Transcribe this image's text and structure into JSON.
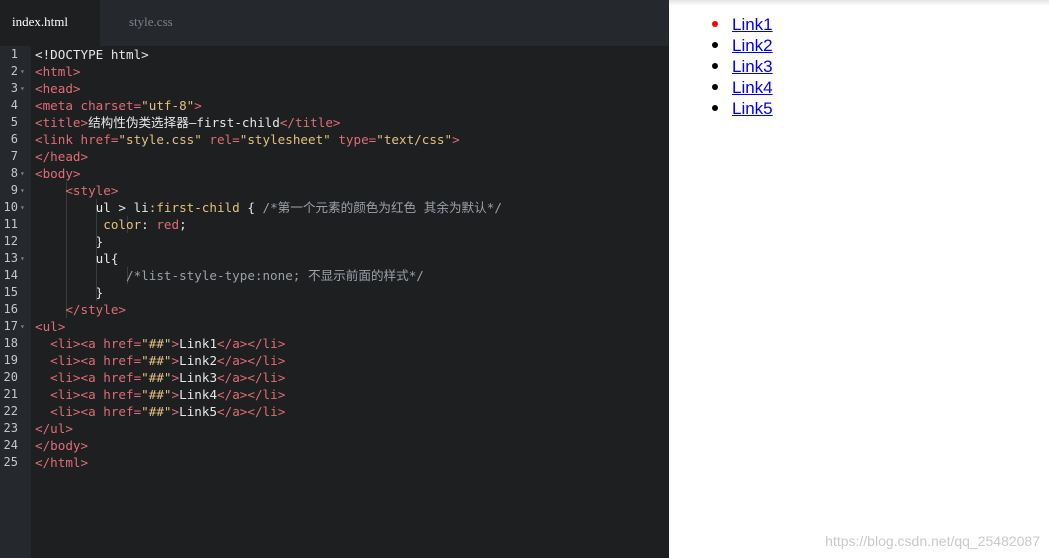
{
  "editor": {
    "tabs": [
      {
        "label": "index.html",
        "active": true
      },
      {
        "label": "style.css",
        "active": false
      }
    ],
    "lines": [
      {
        "num": "1",
        "fold": false,
        "indent": 0,
        "tokens": [
          {
            "t": "<!DOCTYPE html>",
            "c": "text"
          }
        ]
      },
      {
        "num": "2",
        "fold": true,
        "indent": 0,
        "tokens": [
          {
            "t": "<html>",
            "c": "tag"
          }
        ]
      },
      {
        "num": "3",
        "fold": true,
        "indent": 0,
        "tokens": [
          {
            "t": "<head>",
            "c": "tag"
          }
        ]
      },
      {
        "num": "4",
        "fold": false,
        "indent": 0,
        "tokens": [
          {
            "t": "<meta ",
            "c": "tag"
          },
          {
            "t": "charset=",
            "c": "attr"
          },
          {
            "t": "\"utf-8\"",
            "c": "str"
          },
          {
            "t": ">",
            "c": "tag"
          }
        ]
      },
      {
        "num": "5",
        "fold": false,
        "indent": 0,
        "tokens": [
          {
            "t": "<title>",
            "c": "tag"
          },
          {
            "t": "结构性伪类选择器—first-child",
            "c": "text"
          },
          {
            "t": "</title>",
            "c": "tag"
          }
        ]
      },
      {
        "num": "6",
        "fold": false,
        "indent": 0,
        "tokens": [
          {
            "t": "<link ",
            "c": "tag"
          },
          {
            "t": "href=",
            "c": "attr"
          },
          {
            "t": "\"style.css\"",
            "c": "str"
          },
          {
            "t": " rel=",
            "c": "attr"
          },
          {
            "t": "\"stylesheet\"",
            "c": "str"
          },
          {
            "t": " type=",
            "c": "attr"
          },
          {
            "t": "\"text/css\"",
            "c": "str"
          },
          {
            "t": ">",
            "c": "tag"
          }
        ]
      },
      {
        "num": "7",
        "fold": false,
        "indent": 0,
        "tokens": [
          {
            "t": "</head>",
            "c": "tag"
          }
        ]
      },
      {
        "num": "8",
        "fold": true,
        "indent": 0,
        "tokens": [
          {
            "t": "<body>",
            "c": "tag"
          }
        ]
      },
      {
        "num": "9",
        "fold": true,
        "indent": 1,
        "tokens": [
          {
            "t": "    ",
            "c": "text"
          },
          {
            "t": "<style>",
            "c": "tag"
          }
        ]
      },
      {
        "num": "10",
        "fold": true,
        "indent": 2,
        "tokens": [
          {
            "t": "        ul > li",
            "c": "sel"
          },
          {
            "t": ":first-child",
            "c": "pseudo"
          },
          {
            "t": " { ",
            "c": "text"
          },
          {
            "t": "/*第一个元素的颜色为红色 其余为默认*/",
            "c": "comment"
          }
        ]
      },
      {
        "num": "11",
        "fold": false,
        "indent": 3,
        "tokens": [
          {
            "t": "         ",
            "c": "text"
          },
          {
            "t": "color",
            "c": "prop"
          },
          {
            "t": ": ",
            "c": "text"
          },
          {
            "t": "red",
            "c": "val"
          },
          {
            "t": ";",
            "c": "text"
          }
        ]
      },
      {
        "num": "12",
        "fold": false,
        "indent": 2,
        "tokens": [
          {
            "t": "        }",
            "c": "text"
          }
        ]
      },
      {
        "num": "13",
        "fold": true,
        "indent": 2,
        "tokens": [
          {
            "t": "        ul{",
            "c": "sel"
          }
        ]
      },
      {
        "num": "14",
        "fold": false,
        "indent": 3,
        "tokens": [
          {
            "t": "            ",
            "c": "text"
          },
          {
            "t": "/*list-style-type:none; 不显示前面的样式*/",
            "c": "comment"
          }
        ]
      },
      {
        "num": "15",
        "fold": false,
        "indent": 2,
        "tokens": [
          {
            "t": "        }",
            "c": "text"
          }
        ]
      },
      {
        "num": "16",
        "fold": false,
        "indent": 1,
        "tokens": [
          {
            "t": "    ",
            "c": "text"
          },
          {
            "t": "</style>",
            "c": "tag"
          }
        ]
      },
      {
        "num": "17",
        "fold": true,
        "indent": 0,
        "tokens": [
          {
            "t": "<ul>",
            "c": "tag"
          }
        ]
      },
      {
        "num": "18",
        "fold": false,
        "indent": 0,
        "tokens": [
          {
            "t": "  <li><a ",
            "c": "tag"
          },
          {
            "t": "href=",
            "c": "attr"
          },
          {
            "t": "\"##\"",
            "c": "str"
          },
          {
            "t": ">",
            "c": "tag"
          },
          {
            "t": "Link1",
            "c": "text"
          },
          {
            "t": "</a></li>",
            "c": "tag"
          }
        ]
      },
      {
        "num": "19",
        "fold": false,
        "indent": 0,
        "tokens": [
          {
            "t": "  <li><a ",
            "c": "tag"
          },
          {
            "t": "href=",
            "c": "attr"
          },
          {
            "t": "\"##\"",
            "c": "str"
          },
          {
            "t": ">",
            "c": "tag"
          },
          {
            "t": "Link2",
            "c": "text"
          },
          {
            "t": "</a></li>",
            "c": "tag"
          }
        ]
      },
      {
        "num": "20",
        "fold": false,
        "indent": 0,
        "tokens": [
          {
            "t": "  <li><a ",
            "c": "tag"
          },
          {
            "t": "href=",
            "c": "attr"
          },
          {
            "t": "\"##\"",
            "c": "str"
          },
          {
            "t": ">",
            "c": "tag"
          },
          {
            "t": "Link3",
            "c": "text"
          },
          {
            "t": "</a></li>",
            "c": "tag"
          }
        ]
      },
      {
        "num": "21",
        "fold": false,
        "indent": 0,
        "tokens": [
          {
            "t": "  <li><a ",
            "c": "tag"
          },
          {
            "t": "href=",
            "c": "attr"
          },
          {
            "t": "\"##\"",
            "c": "str"
          },
          {
            "t": ">",
            "c": "tag"
          },
          {
            "t": "Link4",
            "c": "text"
          },
          {
            "t": "</a></li>",
            "c": "tag"
          }
        ]
      },
      {
        "num": "22",
        "fold": false,
        "indent": 0,
        "tokens": [
          {
            "t": "  <li><a ",
            "c": "tag"
          },
          {
            "t": "href=",
            "c": "attr"
          },
          {
            "t": "\"##\"",
            "c": "str"
          },
          {
            "t": ">",
            "c": "tag"
          },
          {
            "t": "Link5",
            "c": "text"
          },
          {
            "t": "</a></li>",
            "c": "tag"
          }
        ]
      },
      {
        "num": "23",
        "fold": false,
        "indent": 0,
        "tokens": [
          {
            "t": "</ul>",
            "c": "tag"
          }
        ]
      },
      {
        "num": "24",
        "fold": false,
        "indent": 0,
        "tokens": [
          {
            "t": "</body>",
            "c": "tag"
          }
        ]
      },
      {
        "num": "25",
        "fold": false,
        "indent": 0,
        "tokens": [
          {
            "t": "</html>",
            "c": "tag"
          }
        ]
      }
    ]
  },
  "preview": {
    "links": [
      {
        "label": "Link1",
        "bullet_color": "#ff0000"
      },
      {
        "label": "Link2",
        "bullet_color": "#000000"
      },
      {
        "label": "Link3",
        "bullet_color": "#000000"
      },
      {
        "label": "Link4",
        "bullet_color": "#000000"
      },
      {
        "label": "Link5",
        "bullet_color": "#000000"
      }
    ],
    "watermark": "https://blog.csdn.net/qq_25482087"
  }
}
